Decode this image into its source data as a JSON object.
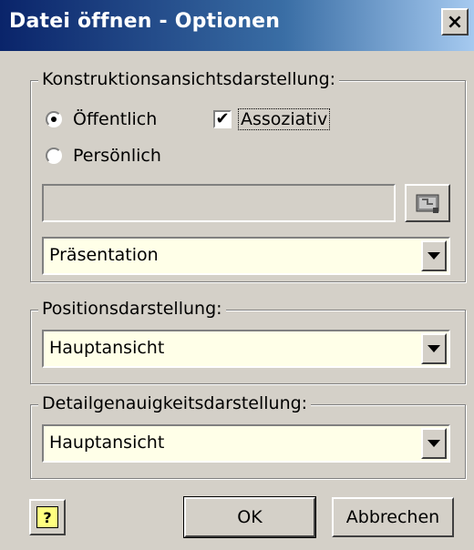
{
  "title": "Datei öffnen - Optionen",
  "close_label": "×",
  "konstruktion": {
    "label": "Konstruktionsansichtsdarstellung:",
    "radio_public": "Öffentlich",
    "radio_private": "Persönlich",
    "selected": "Öffentlich",
    "assoc_label": "Assoziativ",
    "assoc_checked": true,
    "path_value": "",
    "browse_icon": "folder-browse-icon",
    "dropdown_value": "Präsentation"
  },
  "position": {
    "label": "Positionsdarstellung:",
    "dropdown_value": "Hauptansicht"
  },
  "detail": {
    "label": "Detailgenauigkeitsdarstellung:",
    "dropdown_value": "Hauptansicht"
  },
  "buttons": {
    "help_label": "?",
    "ok_label": "OK",
    "cancel_label": "Abbrechen"
  }
}
